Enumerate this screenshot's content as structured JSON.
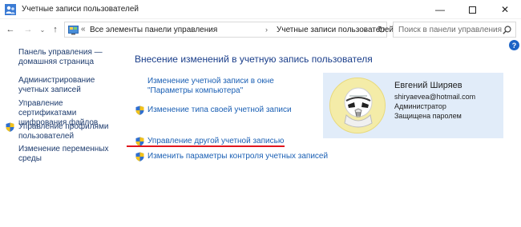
{
  "window": {
    "title": "Учетные записи пользователей",
    "minimize": "—",
    "close": "✕"
  },
  "navigation": {
    "back": "←",
    "forward": "→",
    "recent": "⌄",
    "up": "↑",
    "address_chevron": "«",
    "breadcrumbs": [
      "Все элементы панели управления",
      "Учетные записи пользователей"
    ],
    "separator": "›",
    "dropdown": "⌄",
    "refresh": "↻",
    "search_placeholder": "Поиск в панели управления"
  },
  "help": {
    "label": "?"
  },
  "sidebar": {
    "items": [
      {
        "label": "Панель управления — домашняя страница"
      },
      {
        "label": "Администрирование учетных записей"
      },
      {
        "label": "Управление сертификатами шифрования файлов"
      },
      {
        "label": "Управление профилями пользователей"
      },
      {
        "label": "Изменение переменных среды"
      }
    ]
  },
  "main": {
    "heading": "Внесение изменений в учетную запись пользователя",
    "links": [
      {
        "label": "Изменение учетной записи в окне \"Параметры компьютера\""
      },
      {
        "label": "Изменение типа своей учетной записи"
      },
      {
        "label": "Управление другой учетной записью"
      },
      {
        "label": "Изменить параметры контроля учетных записей"
      }
    ],
    "highlight_color": "#e0141c"
  },
  "user": {
    "name": "Евгений Ширяев",
    "email": "shiryaevea@hotmail.com",
    "role": "Администратор",
    "protection": "Защищена паролем",
    "avatar_icon": "stormtrooper-avatar"
  },
  "colors": {
    "accent": "#1a5fb4",
    "card_background": "#e1ecf9",
    "heading": "#1a3e8a"
  }
}
